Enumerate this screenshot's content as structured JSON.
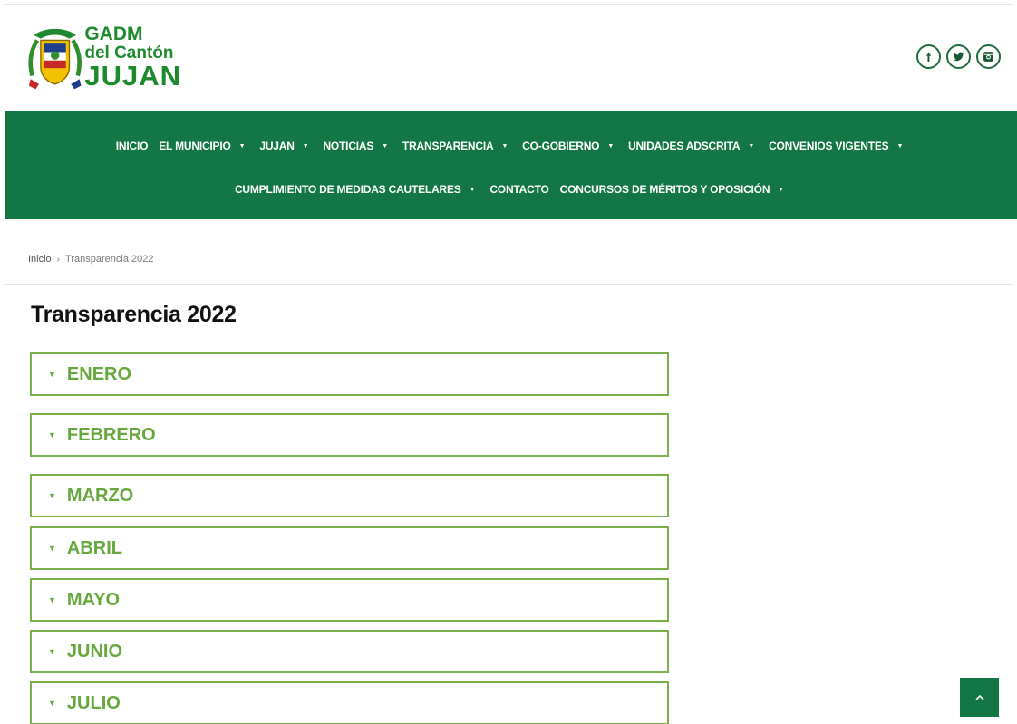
{
  "brand": {
    "line1": "GADM",
    "line2": "del Cantón",
    "line3": "JUJAN",
    "green": "#1e8a2e",
    "yellow": "#f2c200",
    "blue": "#1f3f8c",
    "red": "#c62828"
  },
  "social": {
    "facebook_glyph": "f",
    "twitter_icon": "twitter-icon",
    "instagram_icon": "instagram-icon"
  },
  "nav": {
    "row1": [
      {
        "label": "INICIO",
        "dropdown": false
      },
      {
        "label": "EL MUNICIPIO",
        "dropdown": true
      },
      {
        "label": "JUJAN",
        "dropdown": true
      },
      {
        "label": "NOTICIAS",
        "dropdown": true
      },
      {
        "label": "TRANSPARENCIA",
        "dropdown": true
      },
      {
        "label": "CO-GOBIERNO",
        "dropdown": true
      },
      {
        "label": "UNIDADES ADSCRITA",
        "dropdown": true
      },
      {
        "label": "CONVENIOS VIGENTES",
        "dropdown": true
      }
    ],
    "row2": [
      {
        "label": "CUMPLIMIENTO DE MEDIDAS CAUTELARES",
        "dropdown": true
      },
      {
        "label": "CONTACTO",
        "dropdown": false
      },
      {
        "label": "CONCURSOS DE MÉRITOS Y OPOSICIÓN",
        "dropdown": true
      }
    ],
    "caret": "▼",
    "background": "#137645"
  },
  "breadcrumb": {
    "home": "Inicio",
    "separator": "›",
    "current": "Transparencia 2022"
  },
  "page_title": "Transparencia 2022",
  "accordion": {
    "caret": "▼",
    "items": [
      {
        "label": "ENERO"
      },
      {
        "label": "FEBRERO"
      },
      {
        "label": "MARZO"
      },
      {
        "label": "ABRIL"
      },
      {
        "label": "MAYO"
      },
      {
        "label": "JUNIO"
      },
      {
        "label": "JULIO"
      }
    ],
    "border_color": "#7ab04a",
    "text_color": "#67a83d"
  },
  "back_to_top": {
    "icon": "chevron-up-icon"
  }
}
